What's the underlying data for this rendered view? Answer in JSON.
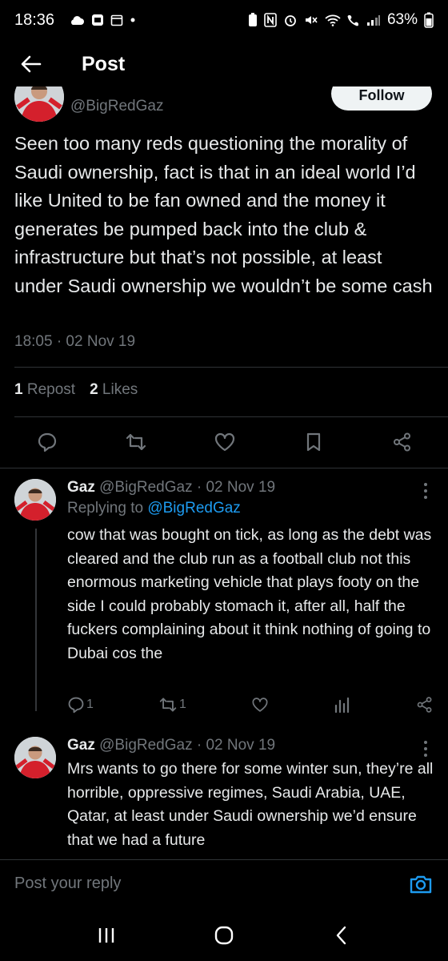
{
  "status_bar": {
    "time": "18:36",
    "battery": "63%"
  },
  "header": {
    "title": "Post"
  },
  "main_post": {
    "handle": "@BigRedGaz",
    "follow_label": "Follow",
    "text": "Seen too many reds questioning the morality of Saudi ownership, fact is that in an ideal world I’d like United to be fan owned and the money it generates be pumped back into the club & infrastructure but that’s not possible, at least under Saudi ownership we wouldn’t be some cash",
    "timestamp": "18:05 · 02 Nov 19",
    "reposts_count": "1",
    "reposts_label": "Repost",
    "likes_count": "2",
    "likes_label": "Likes"
  },
  "replies": [
    {
      "name": "Gaz",
      "meta": "@BigRedGaz · 02 Nov 19",
      "replying_prefix": "Replying to",
      "replying_to": "@BigRedGaz",
      "text": "cow that was bought on tick, as long as the debt was cleared and the club run as a football club not this enormous marketing vehicle that plays footy on the side I could probably stomach it, after all, half the fuckers complaining about it think nothing of going to Dubai cos the",
      "reply_count": "1",
      "repost_count": "1"
    },
    {
      "name": "Gaz",
      "meta": "@BigRedGaz · 02 Nov 19",
      "text": "Mrs wants to go there for some winter sun, they’re all horrible, oppressive regimes, Saudi Arabia, UAE, Qatar, at least under Saudi ownership we’d ensure that we had a future"
    }
  ],
  "composer": {
    "placeholder": "Post your reply"
  },
  "colors": {
    "background": "#000000",
    "text": "#e7e9ea",
    "muted": "#71767b",
    "link": "#1d9bf0",
    "divider": "#2f3336"
  }
}
